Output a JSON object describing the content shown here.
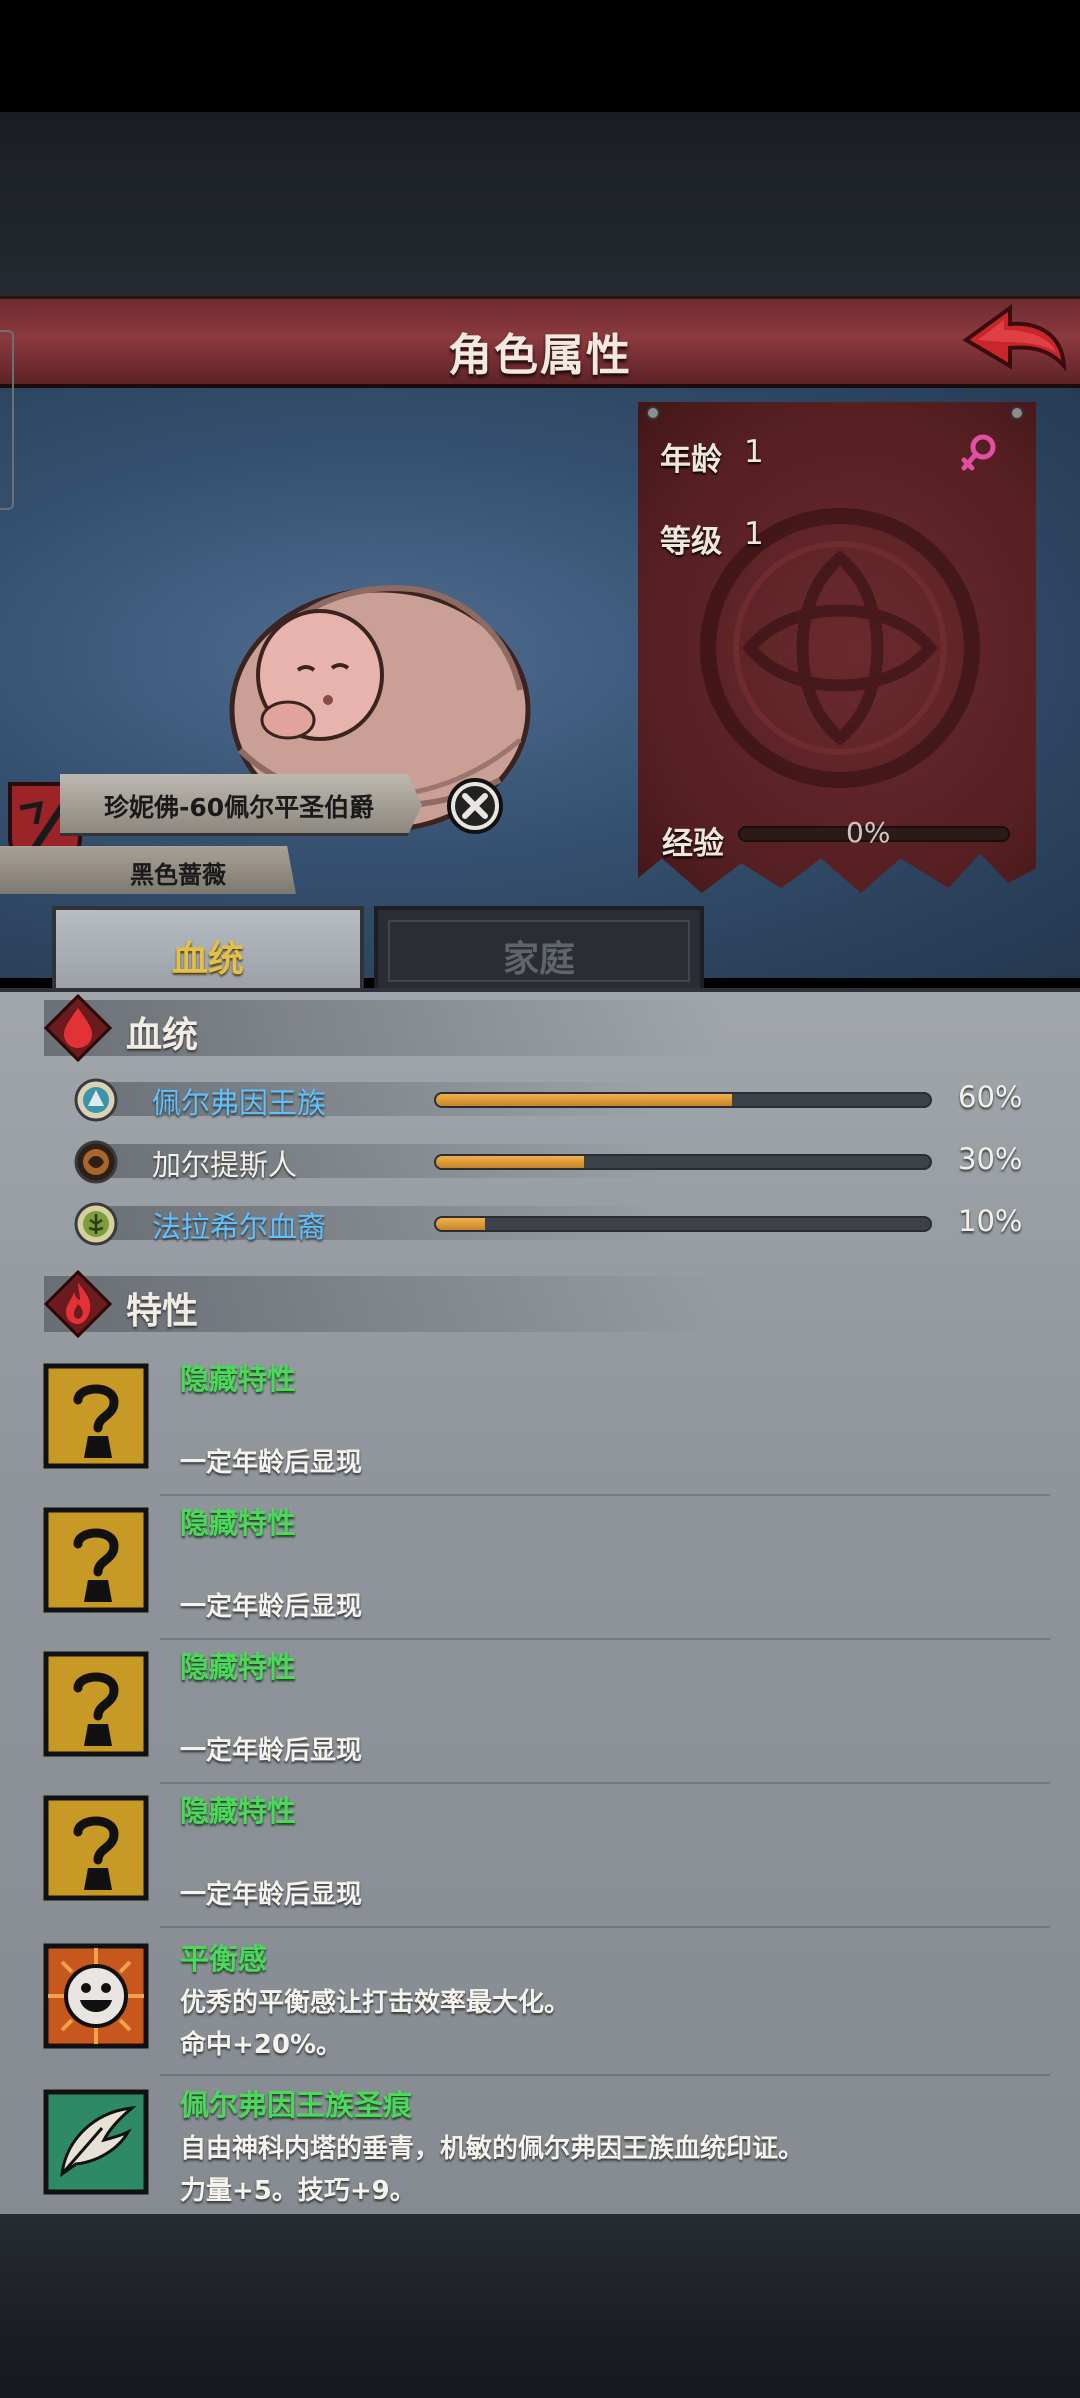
{
  "header": {
    "title": "角色属性"
  },
  "character": {
    "name_title": "珍妮佛-60佩尔平圣伯爵",
    "house": "黑色蔷薇"
  },
  "stats": {
    "age_label": "年龄",
    "age_value": "1",
    "level_label": "等级",
    "level_value": "1",
    "exp_label": "经验",
    "exp_value": "0%",
    "exp_progress": 0,
    "gender": "female-symbol"
  },
  "tabs": [
    {
      "label": "血统",
      "active": true
    },
    {
      "label": "家庭",
      "active": false
    }
  ],
  "lineage": {
    "title": "血统",
    "items": [
      {
        "name": "佩尔弗因王族",
        "percent": "60%",
        "value": 60,
        "color": "#5fc2ff",
        "icon": "pelfoyn-crest-icon"
      },
      {
        "name": "加尔提斯人",
        "percent": "30%",
        "value": 30,
        "color": "#f3f0ea",
        "icon": "galtis-crest-icon"
      },
      {
        "name": "法拉希尔血裔",
        "percent": "10%",
        "value": 10,
        "color": "#5fc2ff",
        "icon": "farashir-tree-icon"
      }
    ]
  },
  "traits": {
    "title": "特性",
    "items": [
      {
        "name": "隐藏特性",
        "desc1": "一定年龄后显现",
        "desc2": "",
        "icon": "hidden-trait-icon"
      },
      {
        "name": "隐藏特性",
        "desc1": "一定年龄后显现",
        "desc2": "",
        "icon": "hidden-trait-icon"
      },
      {
        "name": "隐藏特性",
        "desc1": "一定年龄后显现",
        "desc2": "",
        "icon": "hidden-trait-icon"
      },
      {
        "name": "隐藏特性",
        "desc1": "一定年龄后显现",
        "desc2": "",
        "icon": "hidden-trait-icon"
      },
      {
        "name": "平衡感",
        "desc1": "优秀的平衡感让打击效率最大化。",
        "desc2": "命中+20%。",
        "icon": "smiley-face-icon"
      },
      {
        "name": "佩尔弗因王族圣痕",
        "desc1": "自由神科内塔的垂青，机敏的佩尔弗因王族血统印证。",
        "desc2": "力量+5。技巧+9。",
        "icon": "feather-mark-icon"
      }
    ]
  }
}
